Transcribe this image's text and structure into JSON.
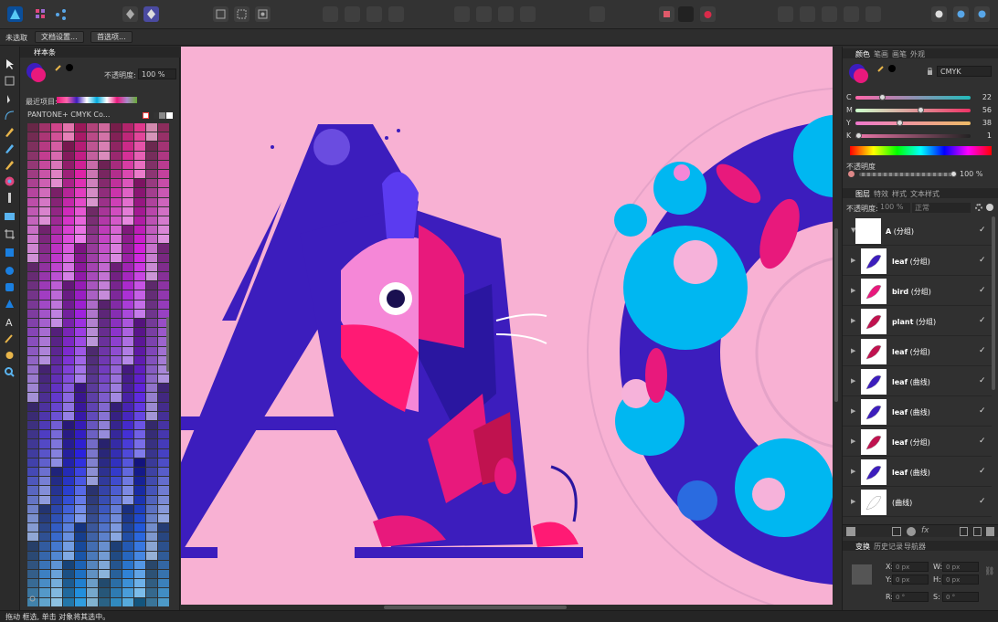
{
  "context_bar": {
    "selection_label": "未选取",
    "doc_setup_label": "文档设置...",
    "prefs_label": "首选项..."
  },
  "swatches": {
    "panel_title": "样本条",
    "opacity_label": "不透明度:",
    "opacity_value": "100 %",
    "recent_label": "最近项目:",
    "palette_name": "PANTONE+ CMYK Co..."
  },
  "colors": {
    "tabs": [
      "颜色",
      "笔画",
      "画笔",
      "外观"
    ],
    "model": "CMYK",
    "channels": [
      {
        "label": "C",
        "value": "22"
      },
      {
        "label": "M",
        "value": "56"
      },
      {
        "label": "Y",
        "value": "38"
      },
      {
        "label": "K",
        "value": "1"
      }
    ],
    "opacity_label": "不透明度",
    "opacity_value": "100 %"
  },
  "layers": {
    "tabs": [
      "图层",
      "特效",
      "样式",
      "文本样式"
    ],
    "opacity_label": "不透明度:",
    "opacity_value": "100 %",
    "blend_mode": "正常",
    "root": {
      "name": "A",
      "kind": "(分组)"
    },
    "items": [
      {
        "name": "leaf",
        "kind": "(分组)"
      },
      {
        "name": "bird",
        "kind": "(分组)"
      },
      {
        "name": "plant",
        "kind": "(分组)"
      },
      {
        "name": "leaf",
        "kind": "(分组)"
      },
      {
        "name": "leaf",
        "kind": "(曲线)"
      },
      {
        "name": "leaf",
        "kind": "(曲线)"
      },
      {
        "name": "leaf",
        "kind": "(分组)"
      },
      {
        "name": "leaf",
        "kind": "(曲线)"
      },
      {
        "name": "",
        "kind": "(曲线)"
      }
    ]
  },
  "transform": {
    "tabs": [
      "变换",
      "历史记录",
      "导航器"
    ],
    "x_label": "X:",
    "x_value": "0 px",
    "y_label": "Y:",
    "y_value": "0 px",
    "w_label": "W:",
    "w_value": "0 px",
    "h_label": "H:",
    "h_value": "0 px",
    "r_label": "R:",
    "r_value": "0 °",
    "s_label": "S:",
    "s_value": "0 °"
  },
  "status": {
    "hint": "拖动 框选, 单击 对象将其选中。"
  },
  "accent": {
    "cyan": "#00b7f1",
    "magenta": "#e8197c",
    "navy": "#3c1dbd",
    "pink_bg": "#f8b1d3"
  }
}
